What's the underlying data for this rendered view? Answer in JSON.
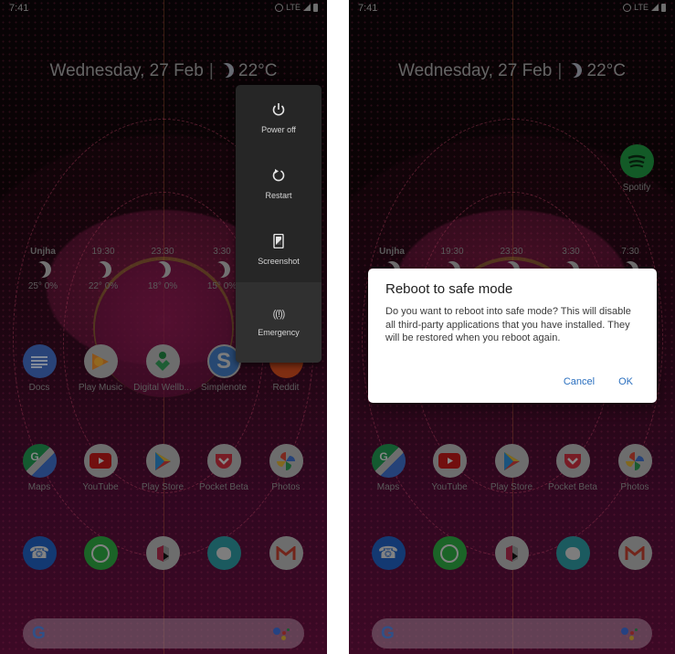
{
  "screens": [
    {
      "status_bar": {
        "time": "7:41",
        "network": "LTE"
      },
      "date_widget": {
        "date": "Wednesday, 27 Feb",
        "separator": "|",
        "temperature": "22°C"
      },
      "weather_forecast": [
        {
          "time": "Unjha",
          "temp": "25° 0%"
        },
        {
          "time": "19:30",
          "temp": "22° 0%"
        },
        {
          "time": "23:30",
          "temp": "18° 0%"
        },
        {
          "time": "3:30",
          "temp": "15° 0%"
        }
      ],
      "apps_row1": [
        {
          "label": "Docs"
        },
        {
          "label": "Play Music"
        },
        {
          "label": "Digital Wellb..."
        },
        {
          "label": "Simplenote"
        },
        {
          "label": "Reddit"
        }
      ],
      "apps_row2": [
        {
          "label": "Maps"
        },
        {
          "label": "YouTube"
        },
        {
          "label": "Play Store"
        },
        {
          "label": "Pocket Beta"
        },
        {
          "label": "Photos"
        }
      ],
      "dock": [
        {
          "label": "Phone"
        },
        {
          "label": "WhatsApp"
        },
        {
          "label": "Unknown app"
        },
        {
          "label": "Kiwi Browser"
        },
        {
          "label": "Gmail"
        }
      ],
      "power_menu": [
        {
          "label": "Power off",
          "icon": "power-icon"
        },
        {
          "label": "Restart",
          "icon": "restart-icon"
        },
        {
          "label": "Screenshot",
          "icon": "screenshot-icon"
        },
        {
          "label": "Emergency",
          "icon": "emergency-icon"
        }
      ]
    },
    {
      "status_bar": {
        "time": "7:41",
        "network": "LTE"
      },
      "date_widget": {
        "date": "Wednesday, 27 Feb",
        "separator": "|",
        "temperature": "22°C"
      },
      "weather_forecast": [
        {
          "time": "Unjha"
        },
        {
          "time": "19:30"
        },
        {
          "time": "23:30"
        },
        {
          "time": "3:30"
        },
        {
          "time": "7:30"
        }
      ],
      "spotify": {
        "label": "Spotify"
      },
      "apps_row2": [
        {
          "label": "Maps"
        },
        {
          "label": "YouTube"
        },
        {
          "label": "Play Store"
        },
        {
          "label": "Pocket Beta"
        },
        {
          "label": "Photos"
        }
      ],
      "dialog": {
        "title": "Reboot to safe mode",
        "message": "Do you want to reboot into safe mode? This will disable all third-party applications that you have installed. They will be restored when you reboot again.",
        "cancel_label": "Cancel",
        "ok_label": "OK"
      }
    }
  ]
}
